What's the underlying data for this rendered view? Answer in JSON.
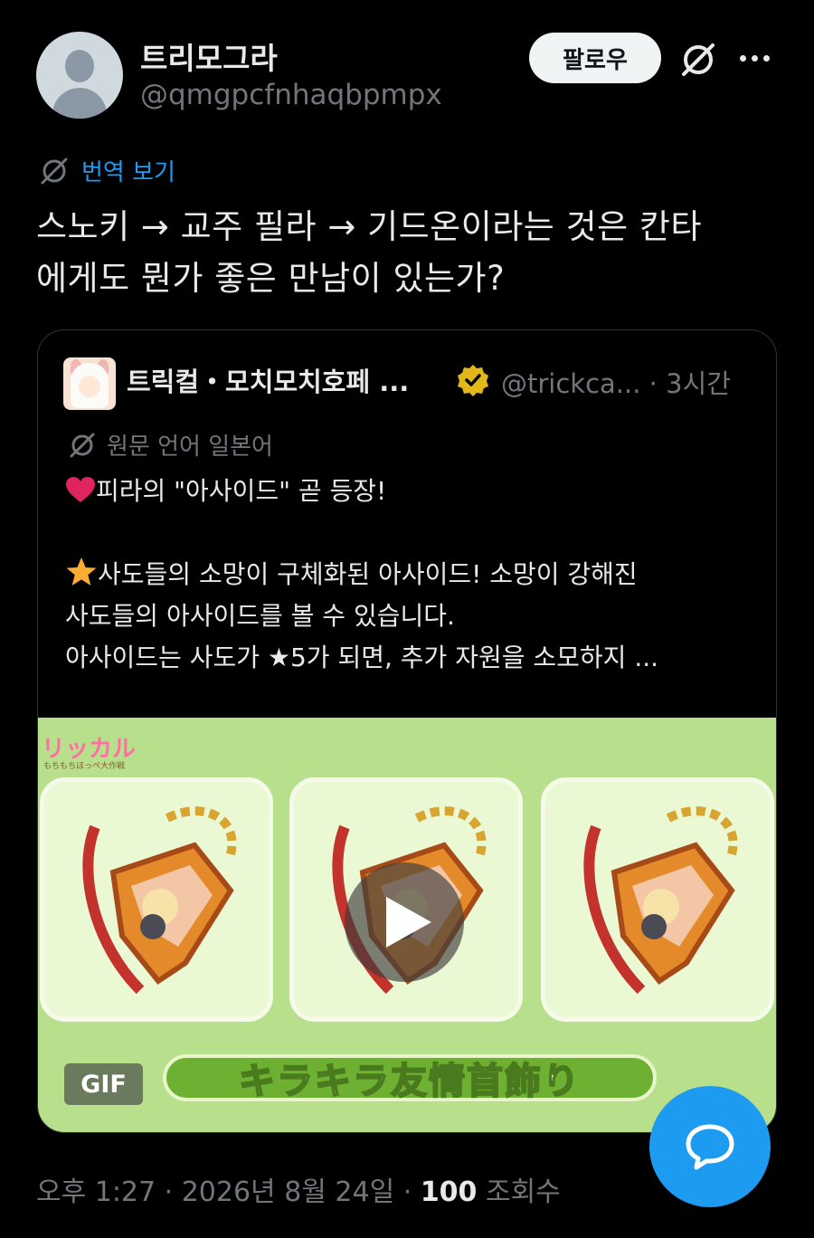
{
  "author": {
    "display_name": "트리모그라",
    "handle": "@qmgpcfnhaqbpmpx",
    "follow_label": "팔로우"
  },
  "icons": {
    "grok": "grok-icon",
    "more": "more-icon",
    "translate": "translate-icon",
    "verified": "verified-badge-icon",
    "play": "play-icon",
    "compose": "reply-bubble-icon"
  },
  "translate": {
    "label": "번역 보기"
  },
  "tweet": {
    "lines": [
      "스노키 → 교주 필라 → 기드온이라는 것은 칸타",
      "에게도 뭔가 좋은 만남이 있는가?"
    ]
  },
  "quote": {
    "name": "트릭컬・모치모치호페 ...",
    "handle_time": "@trickca... · 3시간",
    "lang_note": "원문 언어 일본어",
    "line1": "피라의 \"아사이드\" 곧 등장!",
    "line2": "사도들의 소망이 구체화된 아사이드! 소망이 강해진",
    "line3": "사도들의 아사이드를 볼 수 있습니다.",
    "line4": "아사이드는 사도가 ★5가 되면, 추가 자원을 소모하지 ..."
  },
  "media": {
    "gif_label": "GIF",
    "banner_text": "キラキラ友情首飾り",
    "logo_text": "リッカル",
    "logo_sub": "もちもちほっぺ大作戦"
  },
  "meta": {
    "time_date": "오후 1:27 · 2026년 8월 24일 · ",
    "views_count": "100",
    "views_label": " 조회수"
  },
  "colors": {
    "accent": "#1d9bf0",
    "background": "#000000",
    "muted": "#71767b",
    "verified_gold": "#e2b719"
  }
}
